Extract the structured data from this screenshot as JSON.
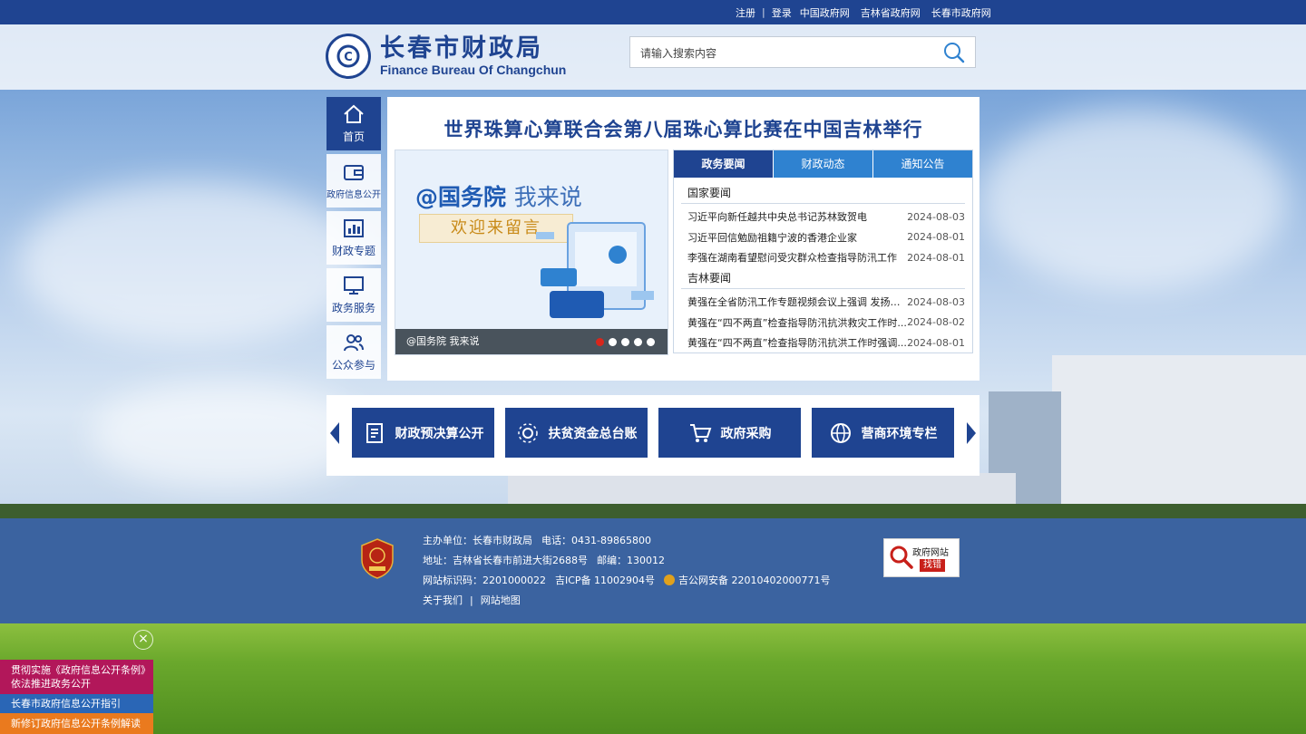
{
  "topbar": {
    "register": "注册",
    "login": "登录",
    "links": [
      "中国政府网",
      "吉林省政府网",
      "长春市政府网"
    ]
  },
  "header": {
    "logo_cn": "长春市财政局",
    "logo_en": "Finance Bureau Of Changchun",
    "search_placeholder": "请输入搜索内容"
  },
  "nav": {
    "items": [
      {
        "label": "首页",
        "icon": "home-icon"
      },
      {
        "label": "政府信息公开",
        "icon": "wallet-icon"
      },
      {
        "label": "财政专题",
        "icon": "chart-icon"
      },
      {
        "label": "政务服务",
        "icon": "monitor-icon"
      },
      {
        "label": "公众参与",
        "icon": "users-icon"
      }
    ]
  },
  "main": {
    "headline": "世界珠算心算联合会第八届珠心算比赛在中国吉林举行",
    "slide": {
      "title_main": "@国务院",
      "title_tail": "我来说",
      "subtitle": "欢迎来留言",
      "caption": "@国务院 我来说",
      "dot_count": 5,
      "active_dot": 0
    },
    "tabs": [
      "政务要闻",
      "财政动态",
      "通知公告"
    ],
    "sections": [
      {
        "title": "国家要闻",
        "items": [
          {
            "title": "习近平向新任越共中央总书记苏林致贺电",
            "date": "2024-08-03"
          },
          {
            "title": "习近平回信勉励祖籍宁波的香港企业家",
            "date": "2024-08-01"
          },
          {
            "title": "李强在湖南看望慰问受灾群众检查指导防汛工作",
            "date": "2024-08-01"
          }
        ]
      },
      {
        "title": "吉林要闻",
        "items": [
          {
            "title": "黄强在全省防汛工作专题视频会议上强调 发扬连...",
            "date": "2024-08-03"
          },
          {
            "title": "黄强在“四不两直”检查指导防汛抗洪救灾工作时...",
            "date": "2024-08-02"
          },
          {
            "title": "黄强在“四不两直”检查指导防汛抗洪工作时强调...",
            "date": "2024-08-01"
          }
        ]
      }
    ]
  },
  "quick_links": [
    {
      "label": "财政预决算公开",
      "icon": "document-icon"
    },
    {
      "label": "扶贫资金总台账",
      "icon": "gear-network-icon"
    },
    {
      "label": "政府采购",
      "icon": "cart-icon"
    },
    {
      "label": "营商环境专栏",
      "icon": "globe-icon"
    }
  ],
  "footer": {
    "sponsor": "主办单位：长春市财政局",
    "phone": "电话：0431-89865800",
    "address": "地址：吉林省长春市前进大街2688号",
    "postcode": "邮编：130012",
    "site_id": "网站标识码：2201000022",
    "icp": "吉ICP备 11002904号",
    "police": "吉公网安备 22010402000771号",
    "about": "关于我们",
    "sitemap": "网站地图",
    "error_report_line1": "政府网站",
    "error_report_line2": "找错"
  },
  "floating": {
    "close": "×",
    "item1_line1": "贯彻实施《政府信息公开条例》",
    "item1_line2": "依法推进政务公开",
    "item2": "长春市政府信息公开指引",
    "item3": "新修订政府信息公开条例解读"
  },
  "colors": {
    "brand_blue": "#1f4491",
    "tab_blue": "#2f82d0",
    "footer_blue": "#3b63a0",
    "accent_red": "#d8261c"
  }
}
